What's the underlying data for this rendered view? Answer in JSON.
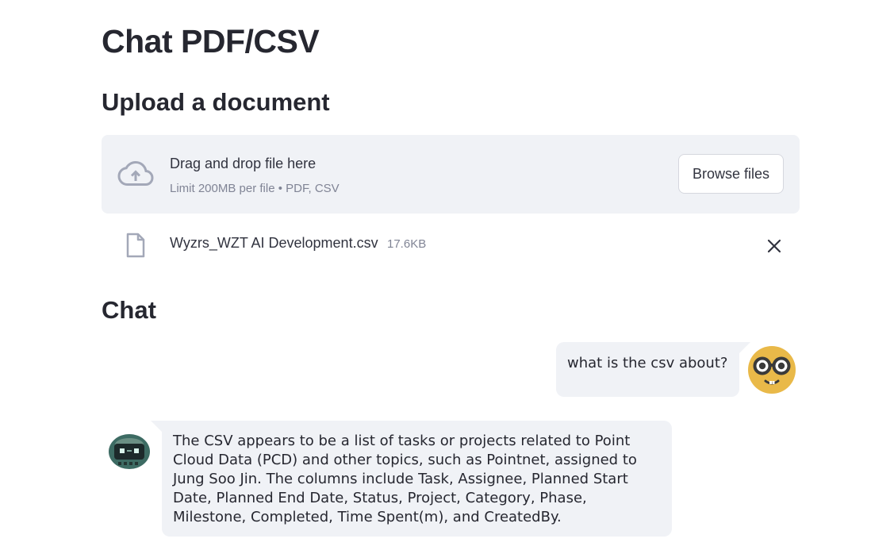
{
  "page": {
    "title": "Chat PDF/CSV"
  },
  "upload": {
    "heading": "Upload a document",
    "drop_text": "Drag and drop file here",
    "limit_text": "Limit 200MB per file • PDF, CSV",
    "browse_label": "Browse files",
    "file": {
      "name": "Wyzrs_WZT AI Development.csv",
      "size": "17.6KB"
    }
  },
  "chat": {
    "heading": "Chat",
    "messages": [
      {
        "role": "user",
        "text": "what is the csv about?"
      },
      {
        "role": "assistant",
        "text": "The CSV appears to be a list of tasks or projects related to Point Cloud Data (PCD) and other topics, such as Pointnet, assigned to Jung Soo Jin. The columns include Task, Assignee, Planned Start Date, Planned End Date, Status, Project, Category, Phase, Milestone, Completed, Time Spent(m), and CreatedBy."
      }
    ]
  },
  "colors": {
    "panel": "#f0f2f6",
    "text": "#31333f",
    "muted": "#808495",
    "user_avatar": "#e9b949"
  },
  "icons": [
    "cloud-upload-icon",
    "file-icon",
    "close-icon",
    "nerd-face-avatar",
    "robot-avatar"
  ]
}
